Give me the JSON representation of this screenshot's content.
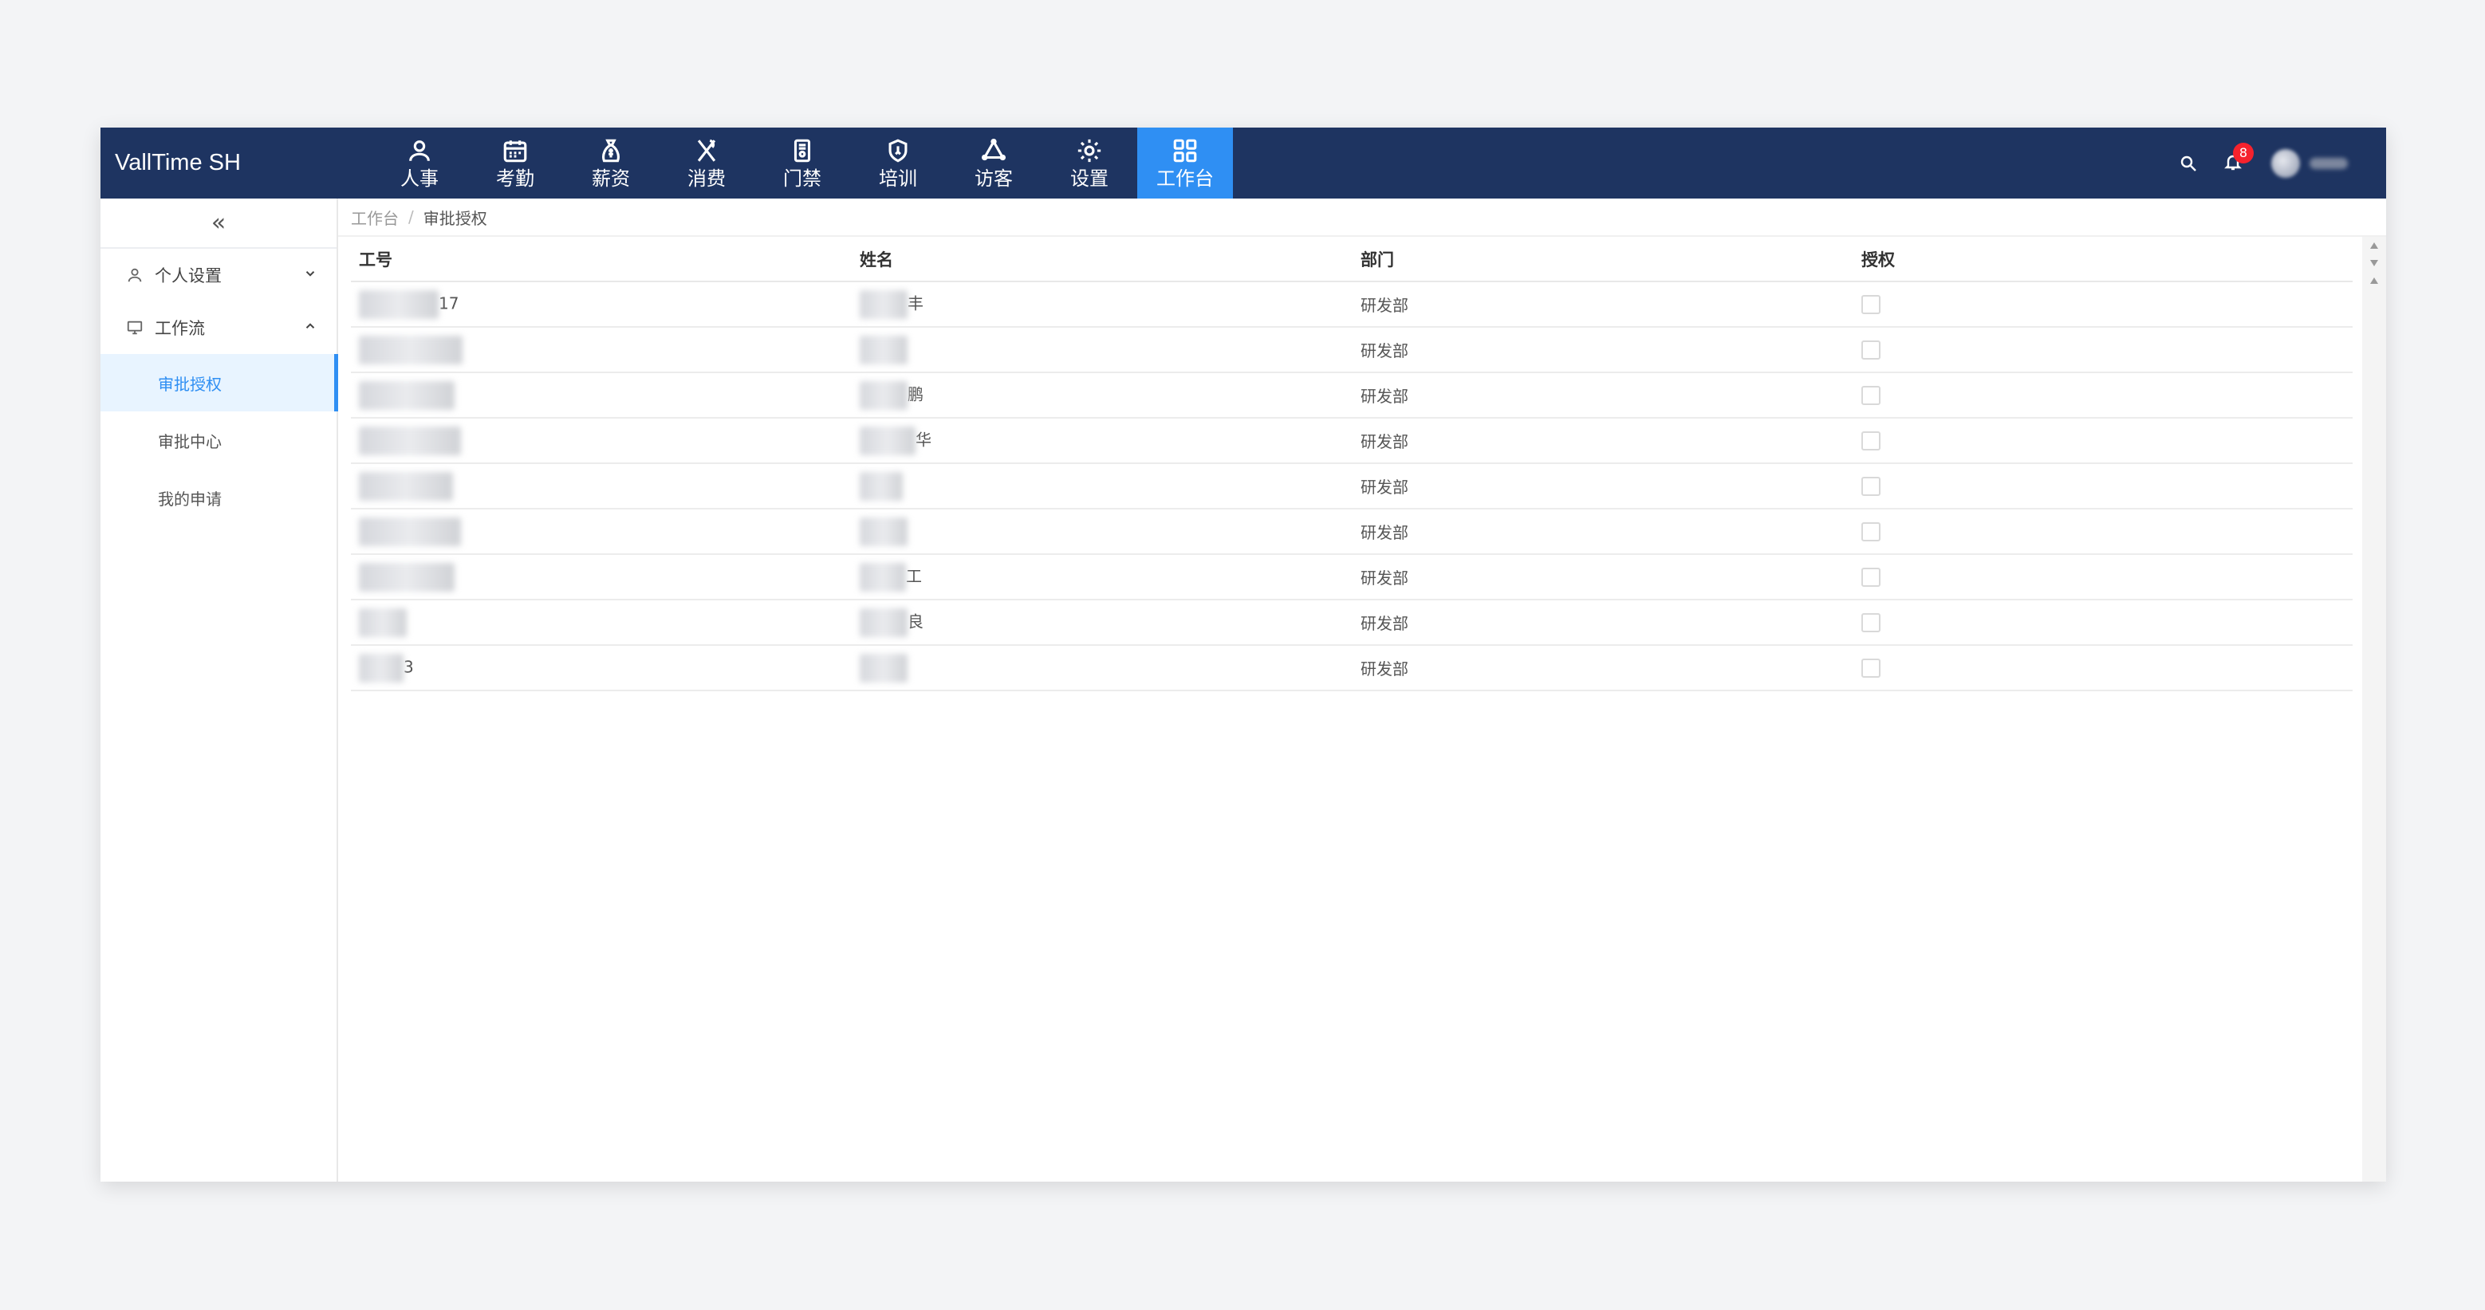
{
  "app": {
    "brand": "VallTime SH"
  },
  "nav": {
    "items": [
      {
        "label": "人事",
        "icon": "person-icon"
      },
      {
        "label": "考勤",
        "icon": "calendar-icon"
      },
      {
        "label": "薪资",
        "icon": "money-bag-icon"
      },
      {
        "label": "消费",
        "icon": "utensils-icon"
      },
      {
        "label": "门禁",
        "icon": "door-access-icon"
      },
      {
        "label": "培训",
        "icon": "training-shield-icon"
      },
      {
        "label": "访客",
        "icon": "visitor-icon"
      },
      {
        "label": "设置",
        "icon": "gear-icon"
      },
      {
        "label": "工作台",
        "icon": "grid-icon",
        "active": true
      }
    ]
  },
  "header": {
    "notification_count": "8"
  },
  "sidebar": {
    "collapse_icon": "«",
    "groups": [
      {
        "label": "个人设置",
        "icon": "user-icon",
        "expanded": false
      },
      {
        "label": "工作流",
        "icon": "monitor-icon",
        "expanded": true,
        "children": [
          {
            "label": "审批授权",
            "active": true
          },
          {
            "label": "审批中心"
          },
          {
            "label": "我的申请"
          }
        ]
      }
    ]
  },
  "breadcrumb": {
    "root": "工作台",
    "separator": "/",
    "current": "审批授权"
  },
  "table": {
    "columns": [
      "工号",
      "姓名",
      "部门",
      "授权"
    ],
    "rows": [
      {
        "id_suffix": "17",
        "name_suffix": "丰",
        "department": "研发部",
        "authorized": false
      },
      {
        "id_suffix": "",
        "name_suffix": "",
        "department": "研发部",
        "authorized": false
      },
      {
        "id_suffix": "",
        "name_suffix": "鹏",
        "department": "研发部",
        "authorized": false
      },
      {
        "id_suffix": "",
        "name_suffix": "华",
        "department": "研发部",
        "authorized": false
      },
      {
        "id_suffix": "",
        "name_suffix": "",
        "department": "研发部",
        "authorized": false
      },
      {
        "id_suffix": "",
        "name_suffix": "",
        "department": "研发部",
        "authorized": false
      },
      {
        "id_suffix": "",
        "name_suffix": "工",
        "department": "研发部",
        "authorized": false
      },
      {
        "id_suffix": "",
        "name_suffix": "良",
        "department": "研发部",
        "authorized": false
      },
      {
        "id_suffix": "3",
        "name_suffix": "",
        "department": "研发部",
        "authorized": false
      }
    ]
  },
  "colors": {
    "topbar": "#1e3461",
    "accent": "#2f8ff3",
    "badge": "#f5222d"
  }
}
